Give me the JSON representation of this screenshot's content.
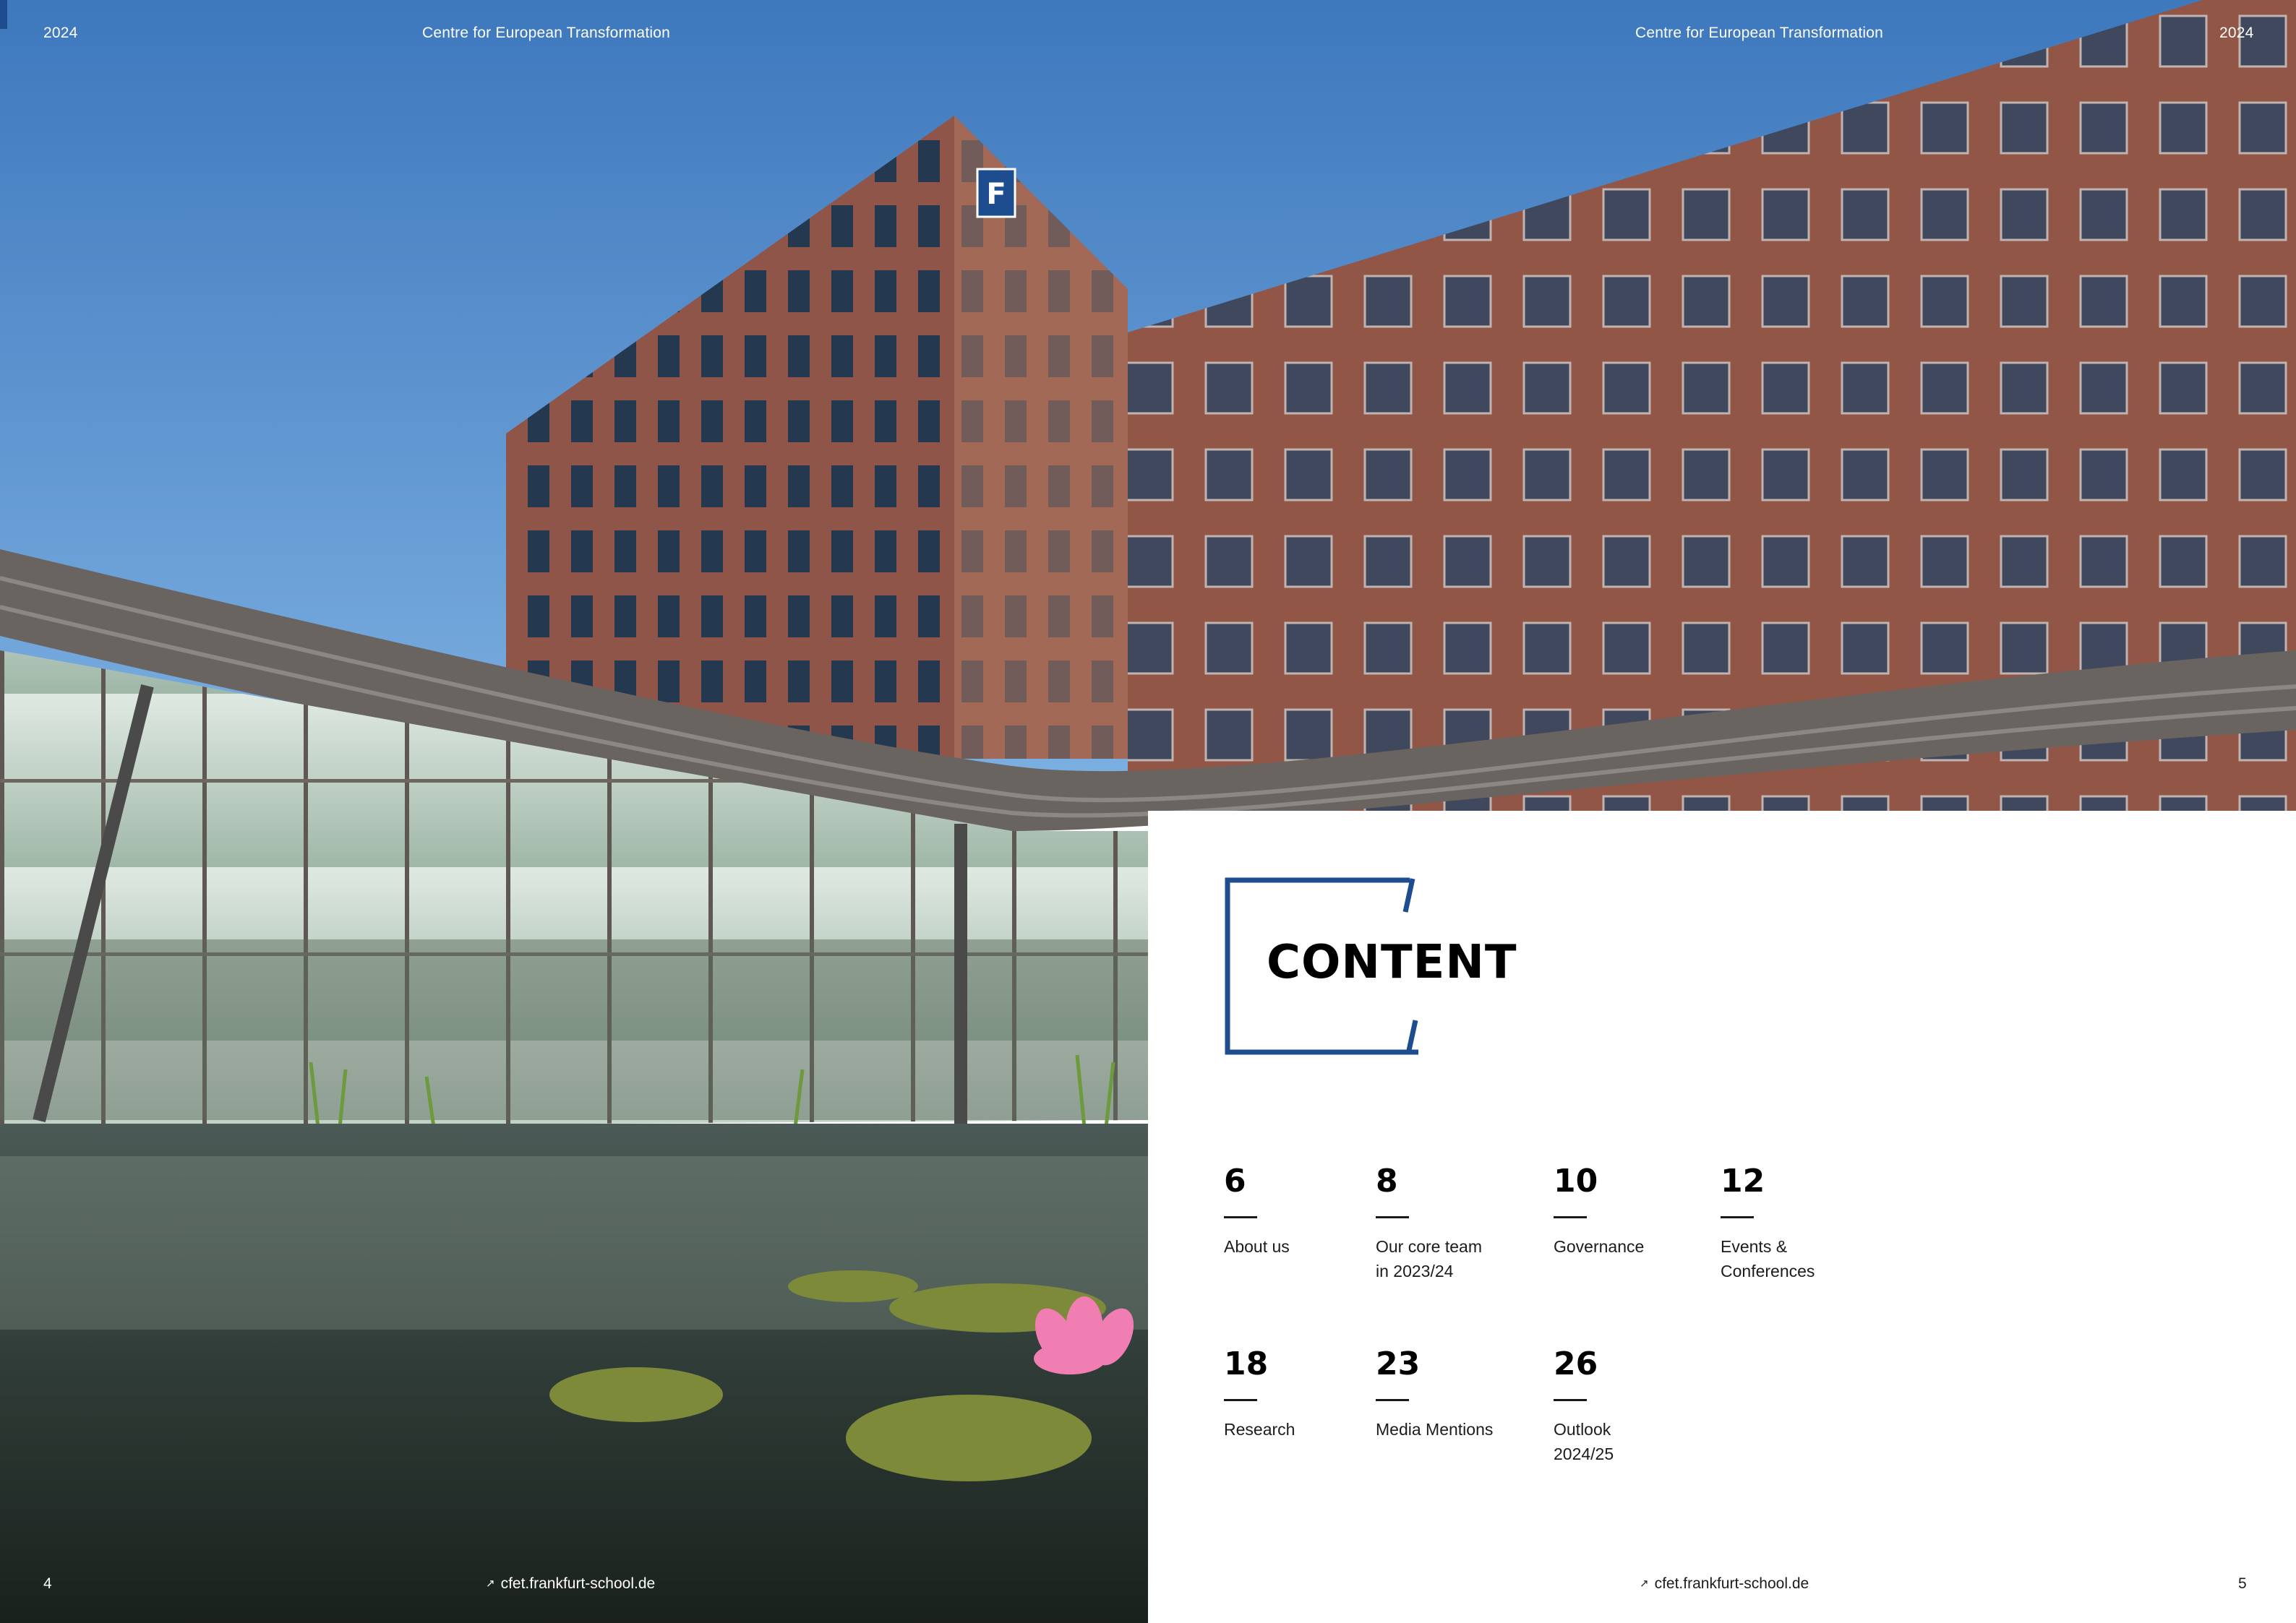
{
  "header": {
    "left_year": "2024",
    "left_title": "Centre for European Transformation",
    "right_title": "Centre for European Transformation",
    "right_year": "2024"
  },
  "footer": {
    "left_page": "4",
    "left_link": "cfet.frankfurt-school.de",
    "right_link": "cfet.frankfurt-school.de",
    "right_page": "5"
  },
  "content": {
    "title": "CONTENT",
    "items": [
      {
        "page": "6",
        "label": "About us"
      },
      {
        "page": "8",
        "label": "Our core team\nin 2023/24"
      },
      {
        "page": "10",
        "label": "Governance"
      },
      {
        "page": "12",
        "label": "Events &\nConferences"
      },
      {
        "page": "18",
        "label": "Research"
      },
      {
        "page": "23",
        "label": "Media Mentions"
      },
      {
        "page": "26",
        "label": "Outlook\n2024/25"
      }
    ]
  },
  "colors": {
    "accent_blue": "#1d4c8f",
    "sky": "#5b93cf",
    "facade": "#9b5b4f"
  },
  "icons": {
    "link_arrow": "north-east-arrow-icon",
    "building_logo": "frankfurt-school-logo"
  }
}
